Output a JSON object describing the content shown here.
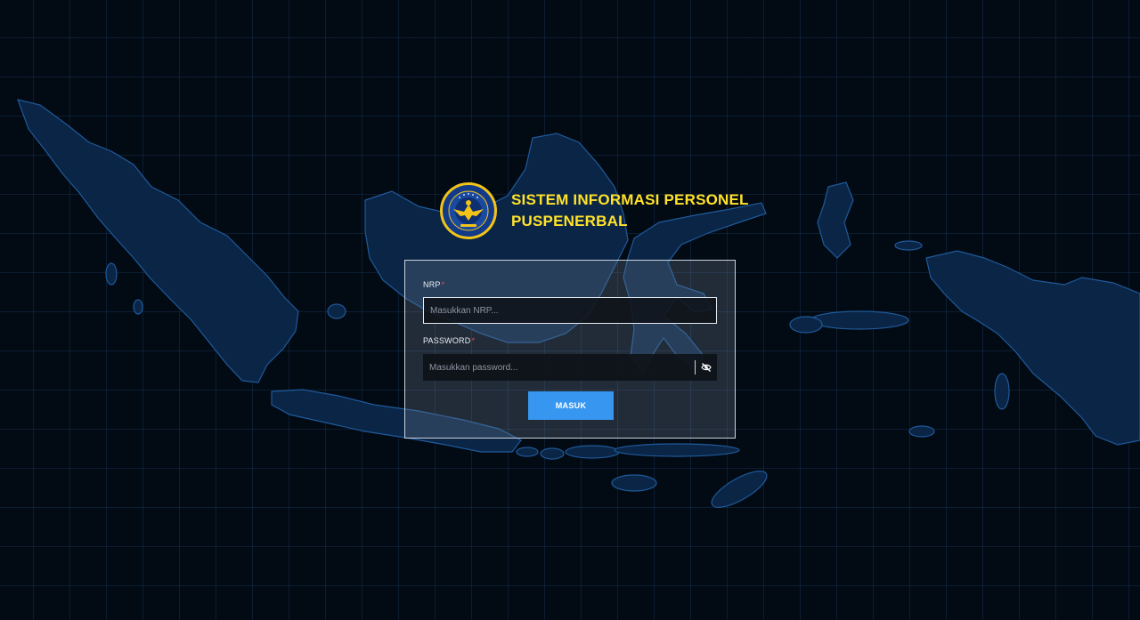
{
  "app": {
    "title_line1": "SISTEM INFORMASI PERSONEL",
    "title_line2": "PUSPENERBAL",
    "logo_icon": "puspenerbal-emblem-icon"
  },
  "form": {
    "nrp_label": "NRP",
    "nrp_required": "*",
    "nrp_placeholder": "Masukkan NRP...",
    "nrp_value": "",
    "password_label": "PASSWORD",
    "password_required": "*",
    "password_placeholder": "Masukkan password...",
    "password_value": "",
    "toggle_icon": "eye-slash-icon",
    "submit_label": "MASUK"
  },
  "colors": {
    "background": "#020a14",
    "map_fill": "#0b2546",
    "map_stroke": "#1e5a9a",
    "title": "#ffe22a",
    "button": "#3797f0",
    "required": "#e05050"
  }
}
